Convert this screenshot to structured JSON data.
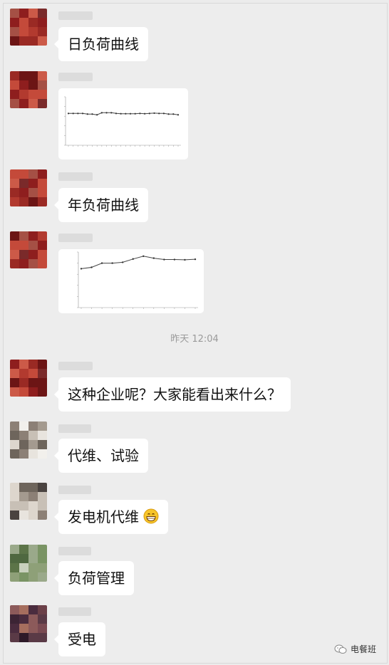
{
  "timestamp": "昨天 12:04",
  "messages": [
    {
      "id": "m1",
      "type": "text",
      "text": "日负荷曲线"
    },
    {
      "id": "m2",
      "type": "image",
      "chart": "daily"
    },
    {
      "id": "m3",
      "type": "text",
      "text": "年负荷曲线"
    },
    {
      "id": "m4",
      "type": "image",
      "chart": "yearly"
    },
    {
      "id": "m5",
      "type": "text",
      "text": "这种企业呢？大家能看出来什么？"
    },
    {
      "id": "m6",
      "type": "text",
      "text": "代维、试验"
    },
    {
      "id": "m7",
      "type": "text",
      "text": "发电机代维",
      "emoji": "grinning-face-icon"
    },
    {
      "id": "m8",
      "type": "text",
      "text": "负荷管理"
    },
    {
      "id": "m9",
      "type": "text",
      "text": "受电"
    }
  ],
  "watermark": {
    "text": "电餐班",
    "icon": "wechat-icon"
  },
  "colors": {
    "background": "#ededed",
    "bubble": "#ffffff"
  },
  "chart_data": [
    {
      "type": "line",
      "title": "",
      "x": [
        "0",
        "1",
        "2",
        "3",
        "4",
        "5",
        "6",
        "7",
        "8",
        "9",
        "10",
        "11",
        "12",
        "13",
        "14",
        "15",
        "16",
        "17",
        "18",
        "19",
        "20",
        "21",
        "22",
        "23"
      ],
      "y": [
        23,
        23,
        23,
        23,
        22.5,
        22.5,
        22,
        23.5,
        23.5,
        23.5,
        23,
        22.8,
        22.8,
        22.8,
        22.8,
        23,
        22.8,
        23,
        23.2,
        23,
        23,
        22.5,
        22.5,
        22
      ],
      "ylim": [
        0,
        35
      ],
      "grid": false
    },
    {
      "type": "line",
      "title": "",
      "x": [
        "1",
        "2",
        "3",
        "4",
        "5",
        "6",
        "7",
        "8",
        "9",
        "10",
        "11",
        "12"
      ],
      "y": [
        140000,
        145000,
        160000,
        160000,
        163000,
        175000,
        185000,
        178000,
        173000,
        173000,
        172000,
        174000
      ],
      "ylim": [
        0,
        200000
      ],
      "grid": false
    }
  ]
}
